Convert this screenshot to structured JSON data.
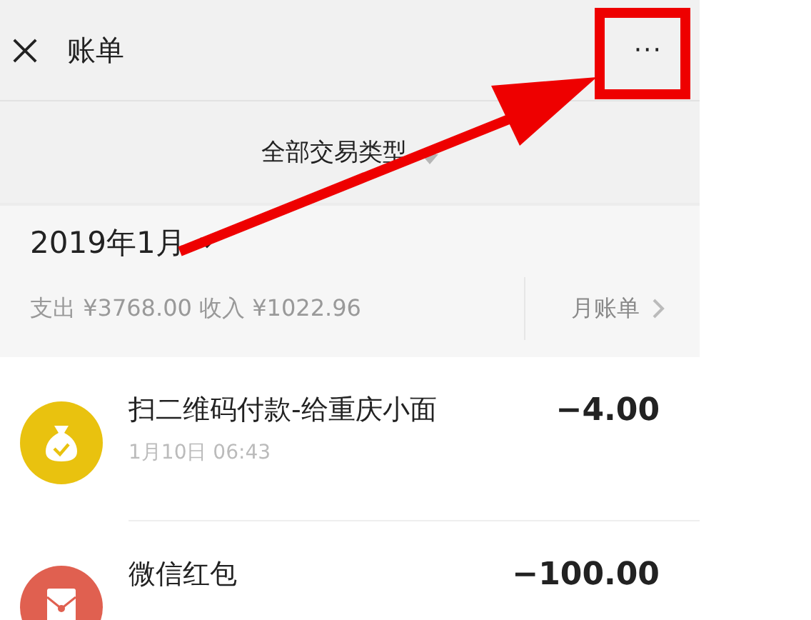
{
  "header": {
    "title": "账单",
    "more": "···"
  },
  "filter": {
    "label": "全部交易类型"
  },
  "month": {
    "title": "2019年1月",
    "summary": "支出 ¥3768.00 收入 ¥1022.96",
    "monthly_bill": "月账单"
  },
  "transactions": [
    {
      "kind": "qr-payment",
      "title": "扫二维码付款-给重庆小面",
      "time": "1月10日 06:43",
      "amount": "−4.00",
      "color": "#e9c20f"
    },
    {
      "kind": "red-packet",
      "title": "微信红包",
      "amount": "−100.00",
      "color": "#e06050"
    }
  ]
}
